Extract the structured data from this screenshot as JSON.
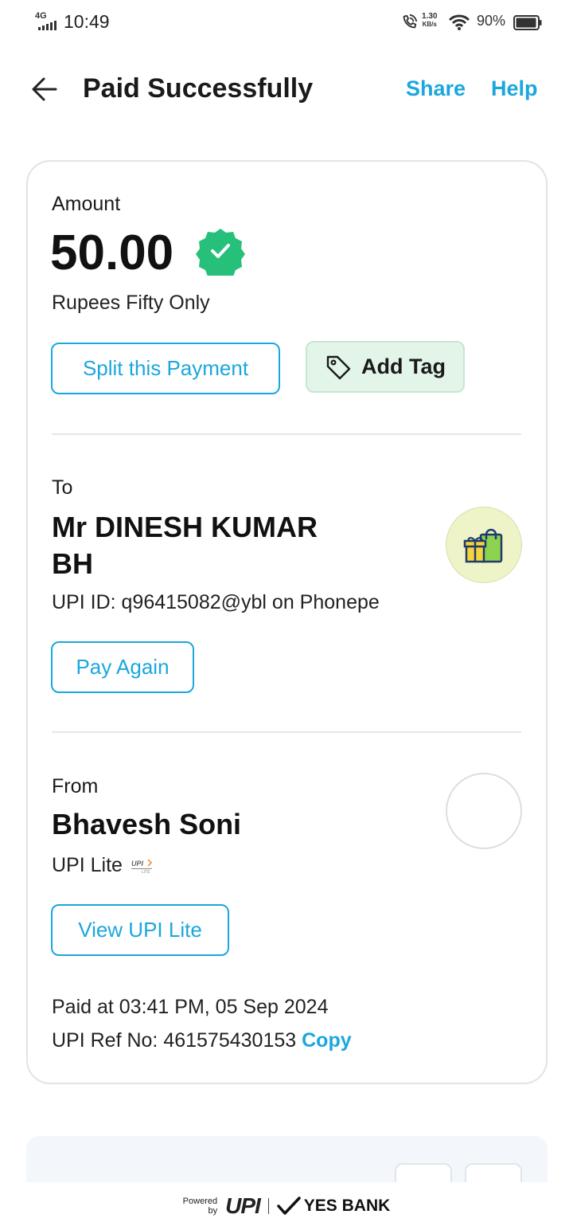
{
  "status_bar": {
    "network": "4G",
    "time": "10:49",
    "speed_value": "1.30",
    "speed_unit": "KB/s",
    "battery": "90%"
  },
  "header": {
    "title": "Paid Successfully",
    "share": "Share",
    "help": "Help"
  },
  "amount": {
    "label": "Amount",
    "value": "50.00",
    "words": "Rupees Fifty Only",
    "verified_icon": "verified-badge-icon",
    "accent": "#1ba7dd",
    "success_color": "#27c07a"
  },
  "actions": {
    "split": "Split this Payment",
    "add_tag": "Add Tag"
  },
  "to": {
    "label": "To",
    "name_line1": "Mr  DINESH KUMAR",
    "name_line2": "BH",
    "upi_id": "UPI ID: q96415082@ybl on Phonepe",
    "pay_again": "Pay Again",
    "avatar_icon": "shopping-gift-icon"
  },
  "from": {
    "label": "From",
    "name": "Bhavesh Soni",
    "method": "UPI Lite",
    "view_button": "View UPI Lite"
  },
  "transaction": {
    "paid_at": "Paid at 03:41 PM, 05 Sep 2024",
    "ref_label": "UPI Ref No: 461575430153",
    "copy": "Copy"
  },
  "footer": {
    "powered": "Powered",
    "by": "by",
    "upi": "UPI",
    "bank": "YES BANK"
  }
}
